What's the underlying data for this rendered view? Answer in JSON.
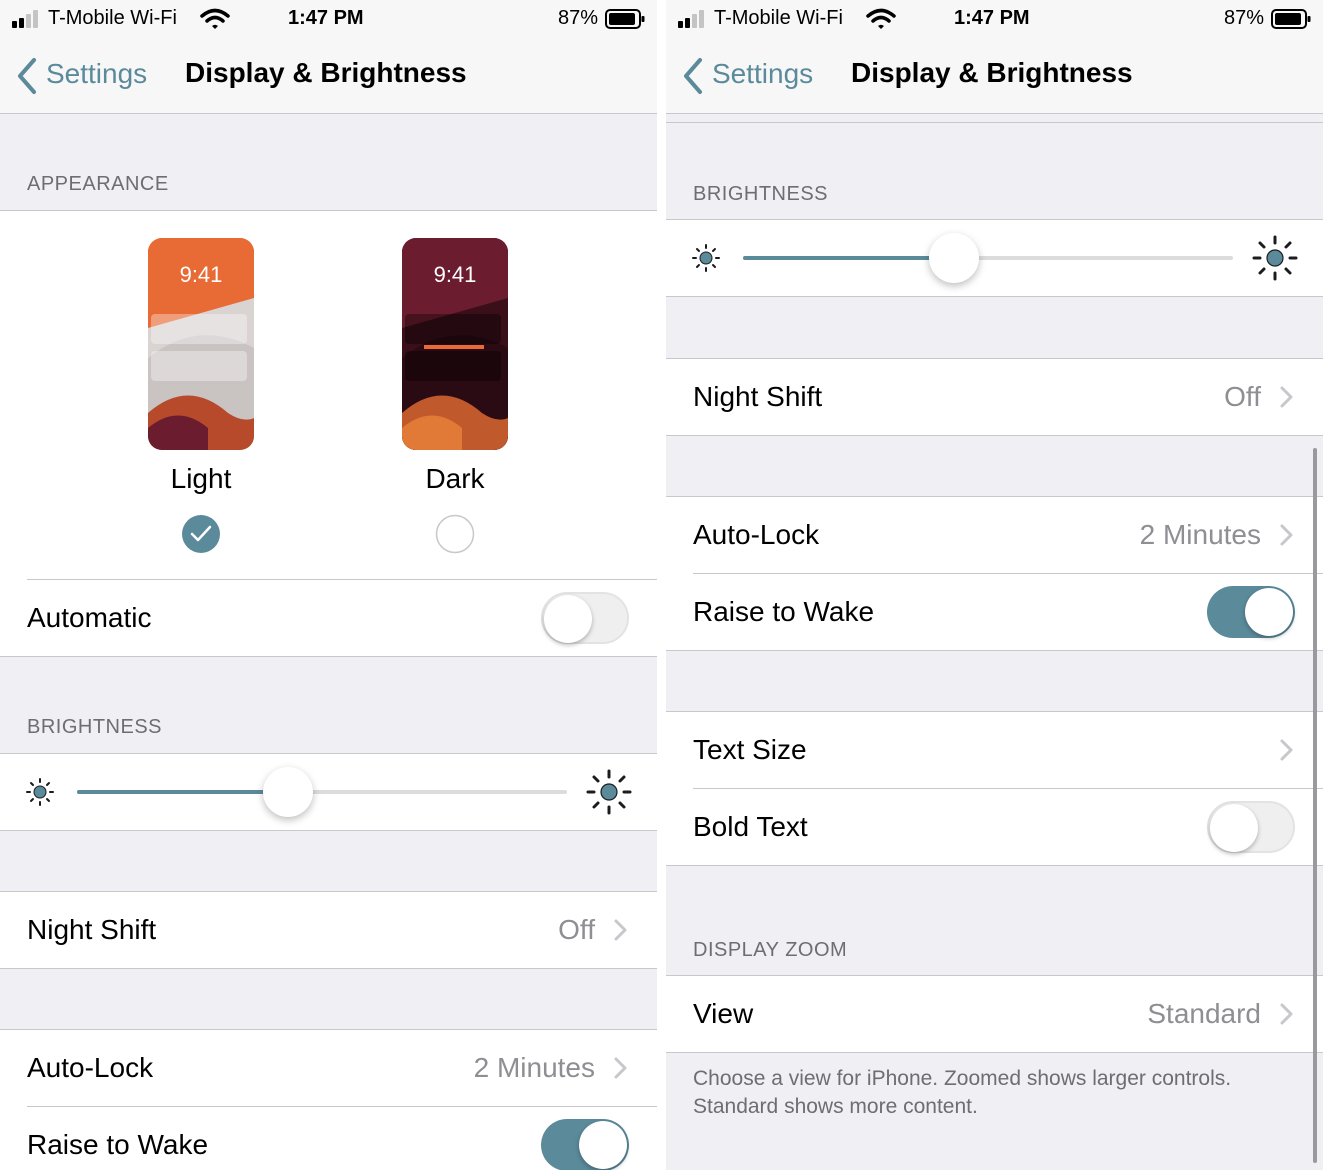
{
  "status_bar": {
    "carrier": "T-Mobile Wi-Fi",
    "time": "1:47 PM",
    "battery": "87%"
  },
  "nav": {
    "back_label": "Settings",
    "title": "Display & Brightness"
  },
  "appearance": {
    "header": "APPEARANCE",
    "options": [
      {
        "label": "Light",
        "preview_time": "9:41",
        "selected": true
      },
      {
        "label": "Dark",
        "preview_time": "9:41",
        "selected": false
      }
    ],
    "automatic_label": "Automatic",
    "automatic_on": false
  },
  "brightness": {
    "header": "BRIGHTNESS",
    "level_fraction": 0.43
  },
  "night_shift": {
    "label": "Night Shift",
    "value": "Off"
  },
  "auto_lock": {
    "label": "Auto-Lock",
    "value": "2 Minutes"
  },
  "raise_to_wake": {
    "label": "Raise to Wake",
    "on": true
  },
  "text_size": {
    "label": "Text Size"
  },
  "bold_text": {
    "label": "Bold Text",
    "on": false
  },
  "display_zoom": {
    "header": "DISPLAY ZOOM",
    "view_label": "View",
    "view_value": "Standard",
    "footer": "Choose a view for iPhone. Zoomed shows larger controls. Standard shows more content."
  },
  "colors": {
    "accent": "#5b8a9b",
    "light_preview": "#e86a34",
    "dark_preview": "#6b1d2f"
  }
}
